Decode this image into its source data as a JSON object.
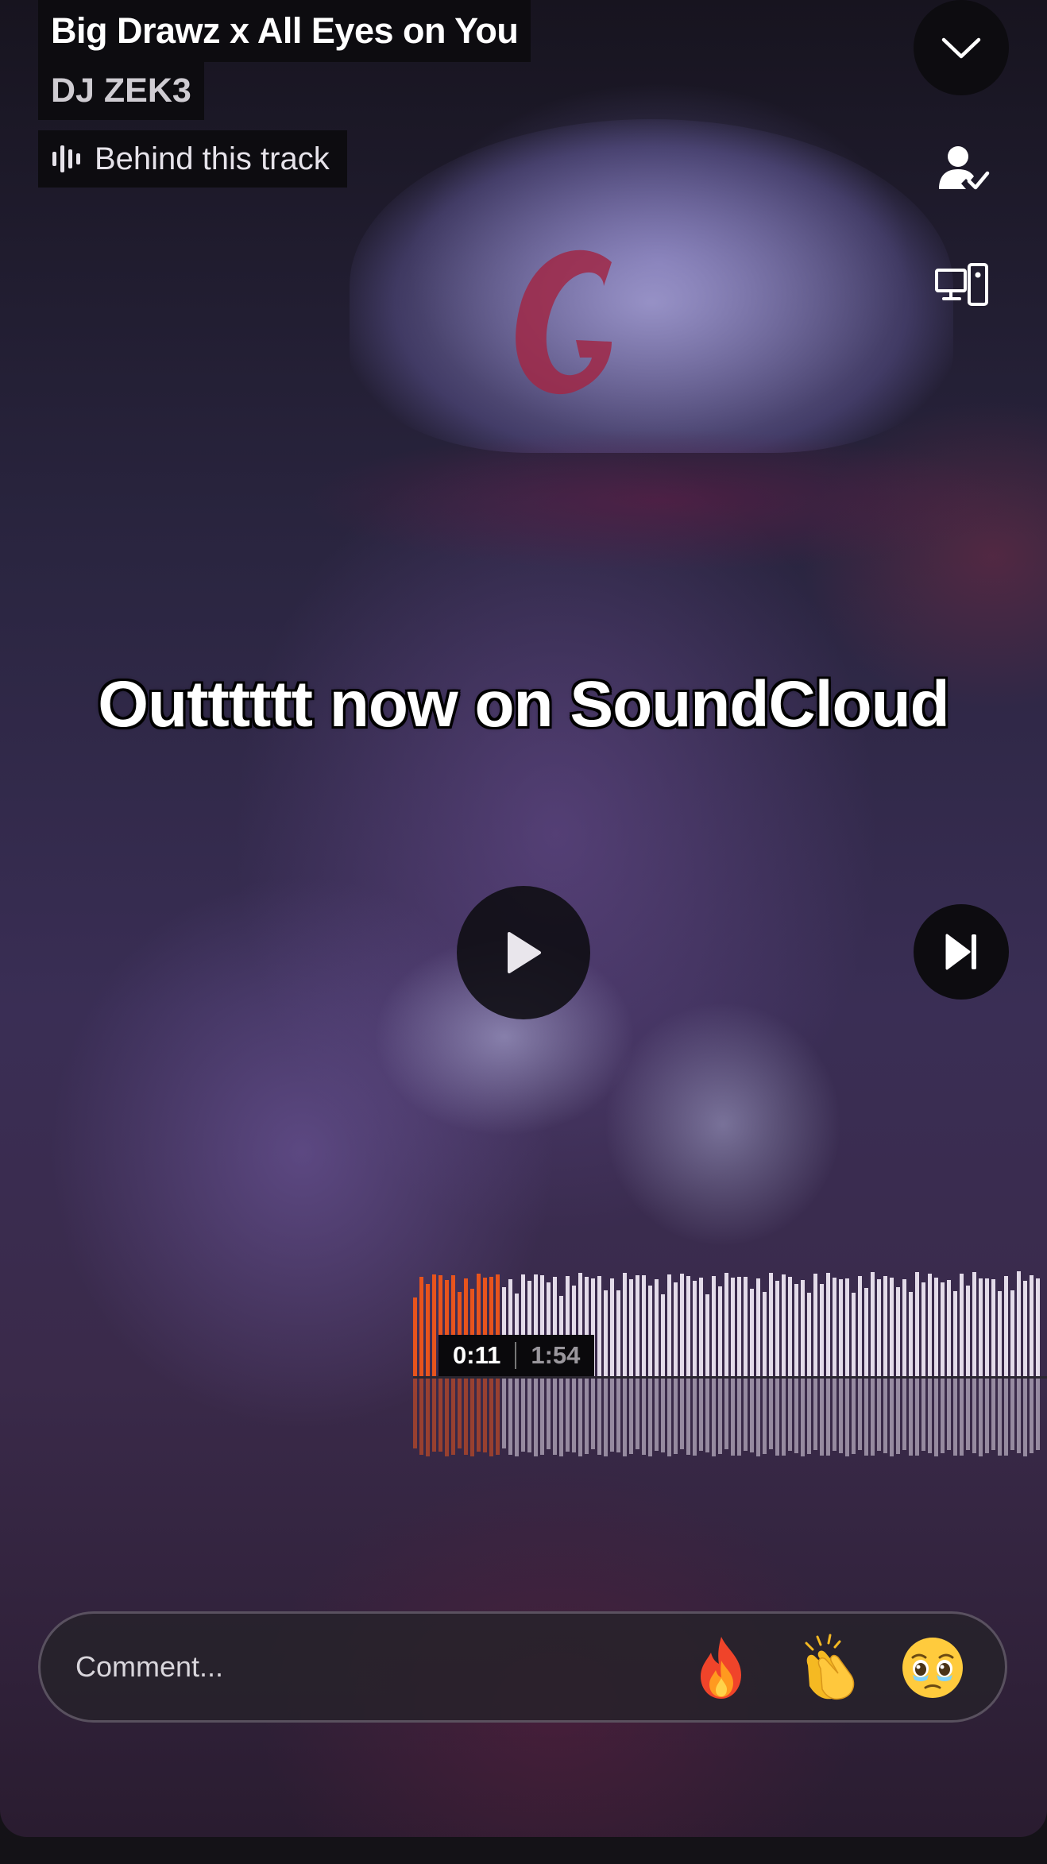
{
  "track": {
    "title": "Big Drawz x All Eyes on You",
    "artist": "DJ ZEK3",
    "behind_label": "Behind this track"
  },
  "overlay": {
    "caption": "Outttttt now on SoundCloud"
  },
  "playback": {
    "current_time": "0:11",
    "total_time": "1:54",
    "progress_fraction": 0.096,
    "state": "paused"
  },
  "comment": {
    "placeholder": "Comment..."
  },
  "reactions": [
    {
      "icon": "fire-emoji"
    },
    {
      "icon": "clapping-hands-emoji"
    },
    {
      "icon": "face-holding-back-tears-emoji"
    }
  ],
  "icons": {
    "collapse": "chevron-down-icon",
    "follow": "user-check-icon",
    "devices": "devices-icon",
    "play": "play-icon",
    "next": "skip-next-icon",
    "behind": "audio-bars-icon"
  },
  "colors": {
    "played_waveform": "#e8541d",
    "unplayed_waveform": "#e3dbe9",
    "pill_background": "#0d0c10"
  }
}
